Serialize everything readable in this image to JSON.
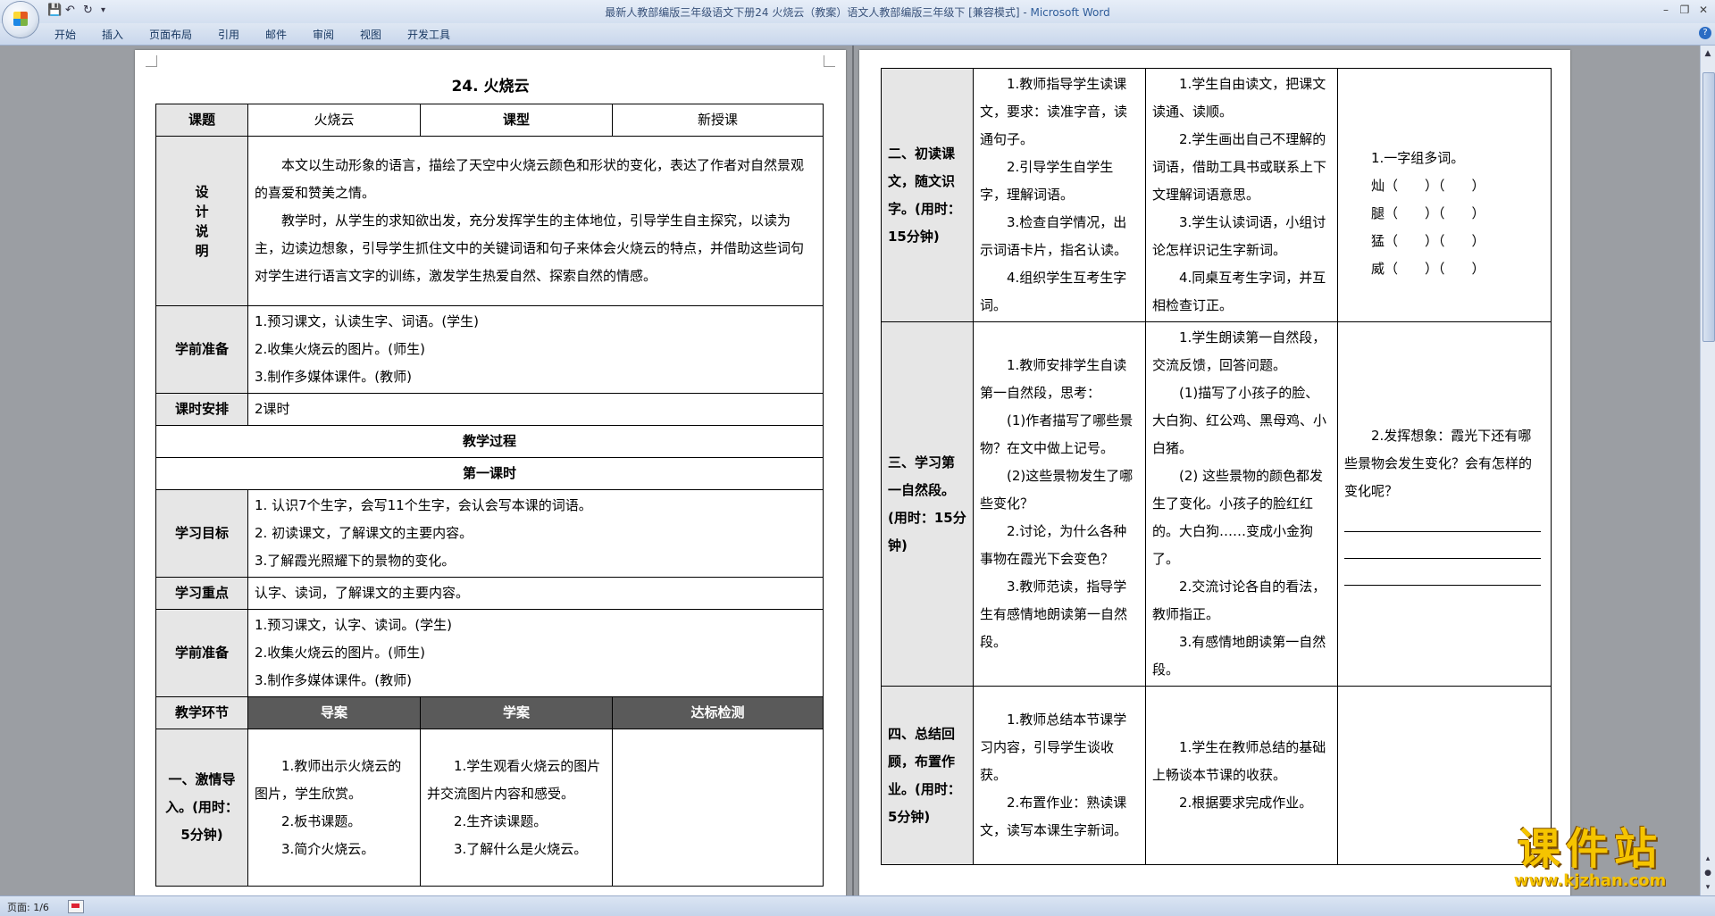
{
  "window": {
    "title": "最新人教部编版三年级语文下册24 火烧云（教案）语文人教部编版三年级下 [兼容模式] - ",
    "app_name": "Microsoft Word"
  },
  "quick_access": {
    "save_icon": "save-icon",
    "undo_icon": "undo-icon",
    "redo_icon": "redo-icon",
    "customize_icon": "customize-icon"
  },
  "ribbon_tabs": [
    "开始",
    "插入",
    "页面布局",
    "引用",
    "邮件",
    "审阅",
    "视图",
    "开发工具"
  ],
  "status": {
    "page": "页面: 1/6"
  },
  "doc": {
    "title": "24. 火烧云",
    "topic_label": "课题",
    "topic_value": "火烧云",
    "type_label": "课型",
    "type_value": "新授课",
    "design_label": "设计说明",
    "design_p1": "本文以生动形象的语言，描绘了天空中火烧云颜色和形状的变化，表达了作者对自然景观的喜爱和赞美之情。",
    "design_p2": "教学时，从学生的求知欲出发，充分发挥学生的主体地位，引导学生自主探究，以读为主，边读边想象，引导学生抓住文中的关键词语和句子来体会火烧云的特点，并借助这些词句对学生进行语言文字的训练，激发学生热爱自然、探索自然的情感。",
    "prep_label": "学前准备",
    "prep_items": [
      "1.预习课文，认读生字、词语。(学生)",
      "2.收集火烧云的图片。(师生)",
      "3.制作多媒体课件。(教师)"
    ],
    "schedule_label": "课时安排",
    "schedule_value": "2课时",
    "process_header": "教学过程",
    "lesson1_header": "第一课时",
    "goals_label": "学习目标",
    "goals_items": [
      "1. 认识7个生字，会写11个生字，会认会写本课的词语。",
      "2. 初读课文，了解课文的主要内容。",
      "3.了解霞光照耀下的景物的变化。"
    ],
    "focus_label": "学习重点",
    "focus_value": "认字、读词，了解课文的主要内容。",
    "prep2_label": "学前准备",
    "prep2_items": [
      "1.预习课文，认字、读词。(学生)",
      "2.收集火烧云的图片。(师生)",
      "3.制作多媒体课件。(教师)"
    ],
    "col_stage": "教学环节",
    "col_guide": "导案",
    "col_study": "学案",
    "col_check": "达标检测",
    "stage1_label": "一、激情导入。(用时：5分钟)",
    "stage1_guide": [
      "1.教师出示火烧云的图片，学生欣赏。",
      "2.板书课题。",
      "3.简介火烧云。"
    ],
    "stage1_study": [
      "1.学生观看火烧云的图片并交流图片内容和感受。",
      "2.生齐读课题。",
      "3.了解什么是火烧云。"
    ],
    "stage2_label": "二、初读课文，随文识字。(用时：15分钟)",
    "stage2_guide": [
      "1.教师指导学生读课文，要求：读准字音，读通句子。",
      "2.引导学生自学生字，理解词语。",
      "3.检查自学情况，出示词语卡片，指名认读。",
      "4.组织学生互考生字词。"
    ],
    "stage2_study": [
      "1.学生自由读文，把课文读通、读顺。",
      "2.学生画出自己不理解的词语，借助工具书或联系上下文理解词语意思。",
      "3.学生认读词语，小组讨论怎样识记生字新词。",
      "4.同桌互考生字词，并互相检查订正。"
    ],
    "stage2_check_title": "1.一字组多词。",
    "stage2_check_items": [
      "灿（　　）（　　）",
      "腿（　　）（　　）",
      "猛（　　）（　　）",
      "威（　　）（　　）"
    ],
    "stage3_label": "三、学习第一自然段。(用时：15分钟)",
    "stage3_guide": [
      "1.教师安排学生自读第一自然段，思考：",
      "(1)作者描写了哪些景物？在文中做上记号。",
      "(2)这些景物发生了哪些变化？",
      "2.讨论，为什么各种事物在霞光下会变色？",
      "3.教师范读，指导学生有感情地朗读第一自然段。"
    ],
    "stage3_study": [
      "1.学生朗读第一自然段，交流反馈，回答问题。",
      "(1)描写了小孩子的脸、大白狗、红公鸡、黑母鸡、小白猪。",
      "(2) 这些景物的颜色都发生了变化。小孩子的脸红红的。大白狗……变成小金狗了。",
      "2.交流讨论各自的看法，教师指正。",
      "3.有感情地朗读第一自然段。"
    ],
    "stage3_check": "2.发挥想象：霞光下还有哪些景物会发生变化？会有怎样的变化呢？",
    "stage4_label": "四、总结回顾，布置作业。(用时：5分钟)",
    "stage4_guide": [
      "1.教师总结本节课学习内容，引导学生谈收获。",
      "2.布置作业：熟读课文，读写本课生字新词。"
    ],
    "stage4_study": [
      "1.学生在教师总结的基础上畅谈本节课的收获。",
      "2.根据要求完成作业。"
    ]
  },
  "watermark": {
    "text": "课件站",
    "url": "www.kjzhan.com"
  }
}
